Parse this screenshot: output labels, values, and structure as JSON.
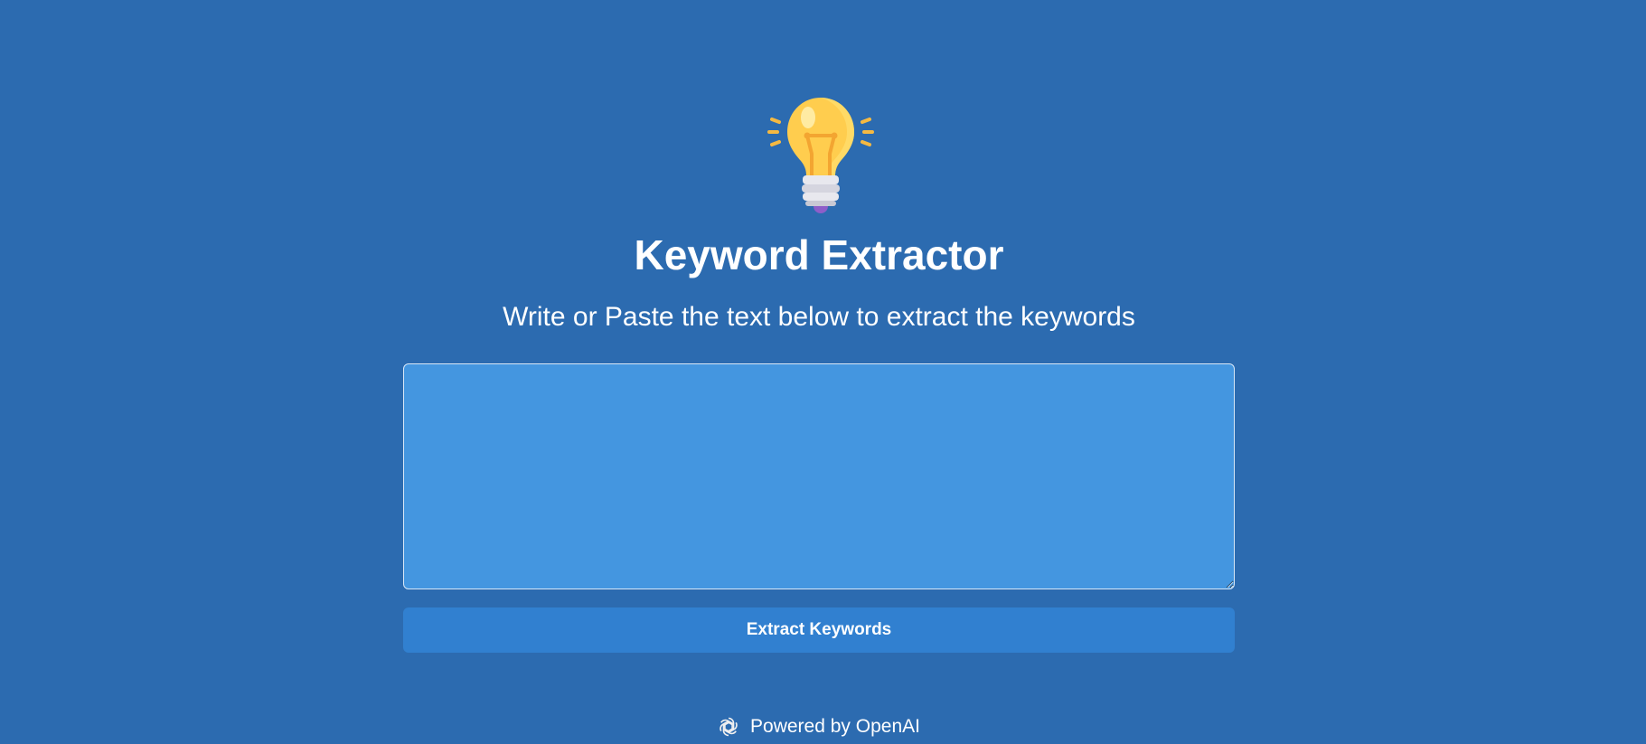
{
  "app": {
    "title": "Keyword Extractor",
    "subtitle": "Write or Paste the text below to extract the keywords"
  },
  "input": {
    "value": "",
    "placeholder": ""
  },
  "actions": {
    "submit_label": "Extract Keywords"
  },
  "footer": {
    "text": "Powered by OpenAI",
    "icon": "openai-logo-icon"
  },
  "icons": {
    "hero": "lightbulb-icon"
  },
  "colors": {
    "background": "#2c6bb0",
    "textarea_background": "#4496e0",
    "button_background": "#3180d0",
    "text": "#ffffff",
    "bulb": "#ffcd4e"
  }
}
